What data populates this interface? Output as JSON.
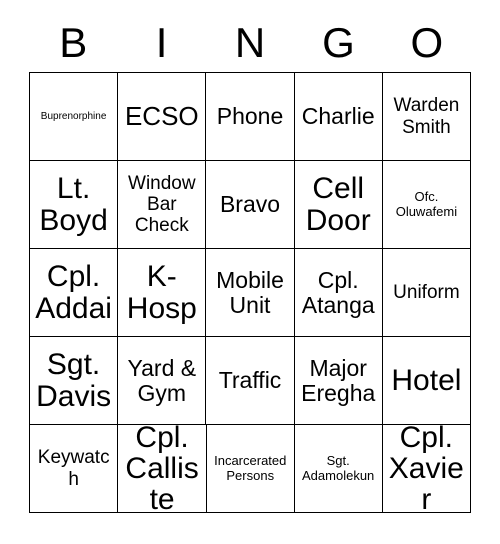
{
  "card": {
    "header_letters": [
      "B",
      "I",
      "N",
      "G",
      "O"
    ],
    "rows": [
      [
        {
          "text": "Buprenorphine",
          "size": "fs-xs"
        },
        {
          "text": "ECSO",
          "size": "fs-xl"
        },
        {
          "text": "Phone",
          "size": "fs-lg"
        },
        {
          "text": "Charlie",
          "size": "fs-lg"
        },
        {
          "text": "Warden Smith",
          "size": "fs-md"
        }
      ],
      [
        {
          "text": "Lt. Boyd",
          "size": "fs-xxl"
        },
        {
          "text": "Window Bar Check",
          "size": "fs-md"
        },
        {
          "text": "Bravo",
          "size": "fs-lg"
        },
        {
          "text": "Cell Door",
          "size": "fs-xxl"
        },
        {
          "text": "Ofc. Oluwafemi",
          "size": "fs-sm"
        }
      ],
      [
        {
          "text": "Cpl. Addai",
          "size": "fs-xxl"
        },
        {
          "text": "K-Hosp",
          "size": "fs-xxl"
        },
        {
          "text": "Mobile Unit",
          "size": "fs-lg"
        },
        {
          "text": "Cpl. Atanga",
          "size": "fs-lg"
        },
        {
          "text": "Uniform",
          "size": "fs-md"
        }
      ],
      [
        {
          "text": "Sgt. Davis",
          "size": "fs-xxl"
        },
        {
          "text": "Yard & Gym",
          "size": "fs-lg"
        },
        {
          "text": "Traffic",
          "size": "fs-lg"
        },
        {
          "text": "Major Eregha",
          "size": "fs-lg"
        },
        {
          "text": "Hotel",
          "size": "fs-xxl"
        }
      ],
      [
        {
          "text": "Keywatch",
          "size": "fs-md"
        },
        {
          "text": "Cpl. Calliste",
          "size": "fs-xxl"
        },
        {
          "text": "Incarcerated Persons",
          "size": "fs-sm"
        },
        {
          "text": "Sgt. Adamolekun",
          "size": "fs-sm"
        },
        {
          "text": "Cpl. Xavier",
          "size": "fs-xxl"
        }
      ]
    ]
  },
  "colors": {
    "border": "#000000",
    "text": "#000000",
    "background": "#ffffff"
  }
}
